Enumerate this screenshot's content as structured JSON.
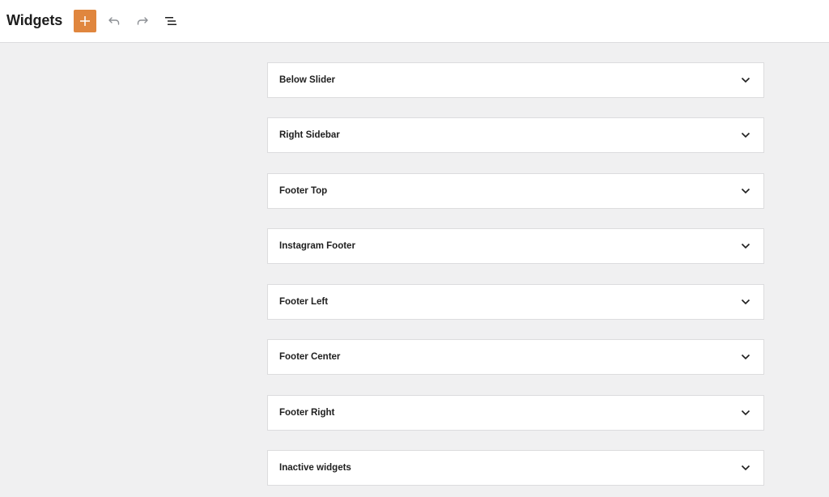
{
  "header": {
    "title": "Widgets",
    "add_button_icon": "plus-icon",
    "undo_icon": "undo-icon",
    "redo_icon": "redo-icon",
    "outline_icon": "list-view-icon"
  },
  "colors": {
    "accent": "#e0863e",
    "background": "#f0f0f1",
    "panel": "#ffffff",
    "border": "#dcdcde",
    "text": "#1e1e1e",
    "muted_icon": "#757575"
  },
  "widget_areas": [
    {
      "label": "Below Slider",
      "expanded": false
    },
    {
      "label": "Right Sidebar",
      "expanded": false
    },
    {
      "label": "Footer Top",
      "expanded": false
    },
    {
      "label": "Instagram Footer",
      "expanded": false
    },
    {
      "label": "Footer Left",
      "expanded": false
    },
    {
      "label": "Footer Center",
      "expanded": false
    },
    {
      "label": "Footer Right",
      "expanded": false
    },
    {
      "label": "Inactive widgets",
      "expanded": false
    }
  ]
}
